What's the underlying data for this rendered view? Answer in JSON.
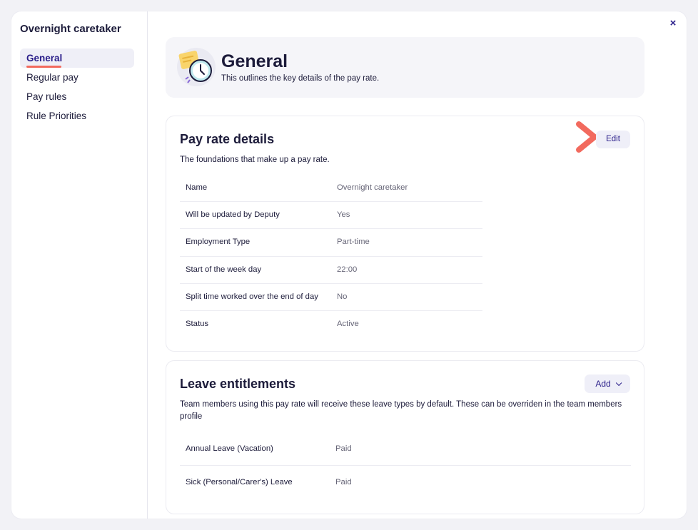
{
  "sidebar": {
    "title": "Overnight caretaker",
    "items": [
      {
        "label": "General"
      },
      {
        "label": "Regular pay"
      },
      {
        "label": "Pay rules"
      },
      {
        "label": "Rule Priorities"
      }
    ]
  },
  "close_label": "×",
  "header": {
    "title": "General",
    "subtitle": "This outlines the key details of the pay rate."
  },
  "pay_rate": {
    "title": "Pay rate details",
    "description": "The foundations that make up a pay rate.",
    "edit_label": "Edit",
    "rows": [
      {
        "key": "Name",
        "value": "Overnight caretaker"
      },
      {
        "key": "Will be updated by Deputy",
        "value": "Yes"
      },
      {
        "key": "Employment Type",
        "value": "Part-time"
      },
      {
        "key": "Start of the week day",
        "value": "22:00"
      },
      {
        "key": "Split time worked over the end of day",
        "value": "No"
      },
      {
        "key": "Status",
        "value": "Active"
      }
    ]
  },
  "leave": {
    "title": "Leave entitlements",
    "description": "Team members using this pay rate will receive these leave types by default. These can be overriden in the team members profile",
    "add_label": "Add",
    "rows": [
      {
        "key": "Annual Leave (Vacation)",
        "value": "Paid"
      },
      {
        "key": "Sick (Personal/Carer's) Leave",
        "value": "Paid"
      }
    ]
  },
  "colors": {
    "accent": "#2a1e8a",
    "highlight": "#f26a5e",
    "button_bg": "#efeff8"
  }
}
